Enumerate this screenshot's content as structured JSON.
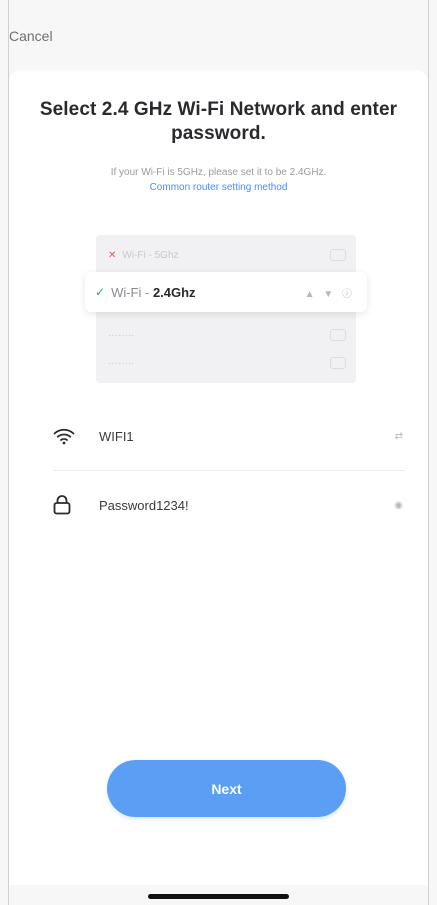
{
  "topbar": {
    "cancel_label": "Cancel"
  },
  "content": {
    "title": "Select 2.4 GHz Wi-Fi Network and enter password.",
    "subtitle": "If your Wi-Fi is 5GHz, please set it to be 2.4GHz.",
    "help_link": "Common router setting method"
  },
  "illustration": {
    "row_5g": "Wi-Fi - 5Ghz",
    "row_24_prefix": "Wi-Fi - ",
    "row_24_band": "2.4Ghz",
    "placeholder_row_1": "········",
    "placeholder_row_2": "········"
  },
  "form": {
    "ssid_value": "WIFI1",
    "ssid_trail": "⇄",
    "password_value": "Password1234!",
    "password_trail": "◉"
  },
  "actions": {
    "next_label": "Next"
  },
  "colors": {
    "accent": "#5b9ff5",
    "link": "#4a8cf7",
    "success_check": "#27b35f",
    "error_x": "#e85a5a"
  }
}
